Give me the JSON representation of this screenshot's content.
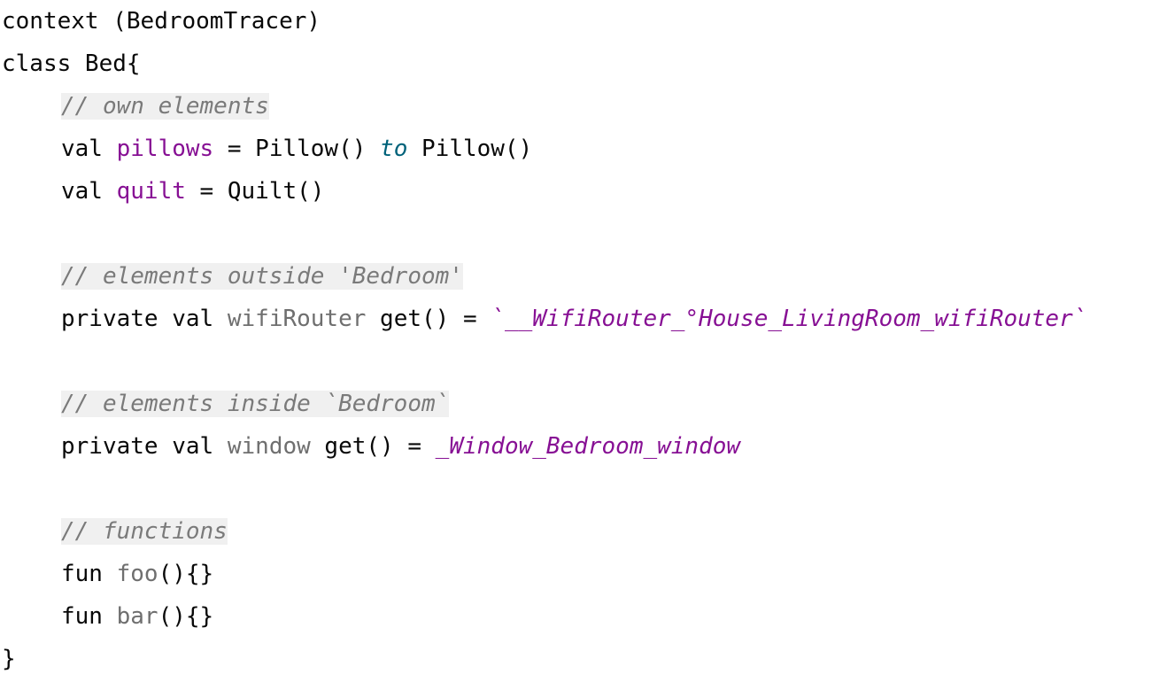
{
  "code": {
    "l1": {
      "context_kw": "context",
      "rest": " (BedroomTracer)"
    },
    "l2": {
      "class_kw": "class",
      "rest": " Bed{"
    },
    "l3": {
      "comment": "// own elements"
    },
    "l4": {
      "val_kw": "val",
      "name": "pillows",
      "eq": " = Pillow() ",
      "infix": "to",
      "rest": " Pillow()"
    },
    "l5": {
      "val_kw": "val",
      "name": "quilt",
      "rest": " = Quilt()"
    },
    "l6": {
      "comment": "// elements outside 'Bedroom'"
    },
    "l7": {
      "private_kw": "private",
      "val_kw": "val",
      "name": "wifiRouter",
      "get": " get() = ",
      "value": "`__WifiRouter_°House_LivingRoom_wifiRouter`"
    },
    "l8": {
      "comment": "// elements inside `Bedroom`"
    },
    "l9": {
      "private_kw": "private",
      "val_kw": "val",
      "name": "window",
      "get": " get() = ",
      "value": "_Window_Bedroom_window"
    },
    "l10": {
      "comment": "// functions"
    },
    "l11": {
      "fun_kw": "fun",
      "name": "foo",
      "rest": "(){}"
    },
    "l12": {
      "fun_kw": "fun",
      "name": "bar",
      "rest": "(){}"
    },
    "l13": {
      "text": "}"
    }
  },
  "colors": {
    "keyword": "#080808",
    "property": "#871094",
    "unused": "#6f6f6f",
    "infix": "#00627a",
    "comment": "#7a7a7a",
    "comment_bg": "#f0f0f0"
  }
}
